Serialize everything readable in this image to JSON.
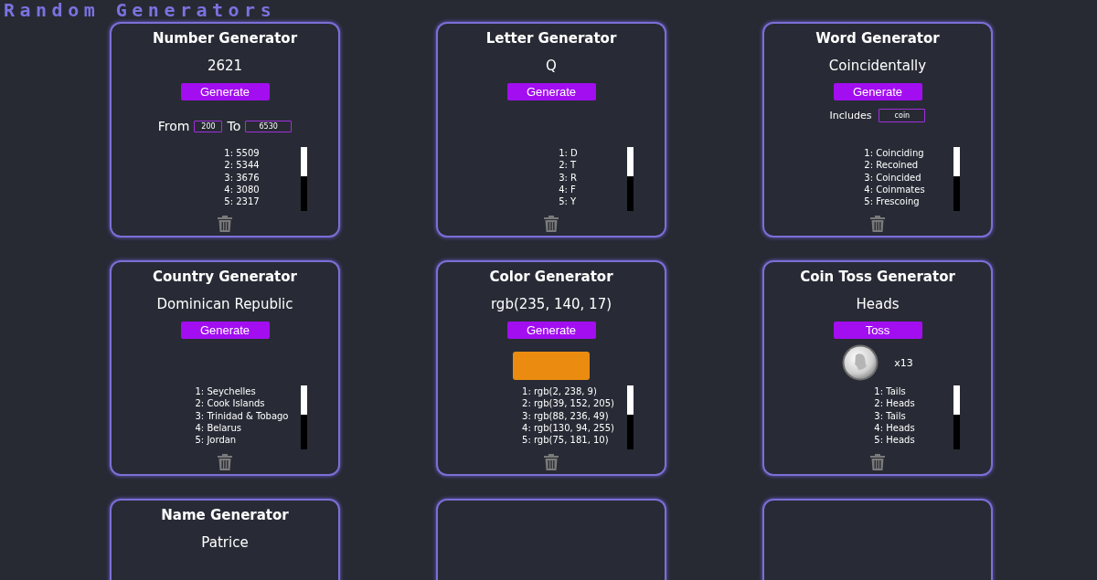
{
  "header": {
    "title": "Random Generators"
  },
  "cards": [
    {
      "kind": "number",
      "title": "Number Generator",
      "value": "2621",
      "button": "Generate",
      "range": {
        "from_label": "From",
        "from": "200",
        "to_label": "To",
        "to": "6530"
      },
      "history": [
        "1: 5509",
        "2: 5344",
        "3: 3676",
        "4: 3080",
        "5: 2317"
      ]
    },
    {
      "kind": "letter",
      "title": "Letter Generator",
      "value": "Q",
      "button": "Generate",
      "history": [
        "1: D",
        "2: T",
        "3: R",
        "4: F",
        "5: Y"
      ]
    },
    {
      "kind": "word",
      "title": "Word Generator",
      "value": "Coincidentally",
      "button": "Generate",
      "filter": {
        "label": "Includes",
        "value": "coin"
      },
      "history": [
        "1: Coinciding",
        "2: Recoined",
        "3: Coincided",
        "4: Coinmates",
        "5: Frescoing"
      ]
    },
    {
      "kind": "country",
      "title": "Country Generator",
      "value": "Dominican Republic",
      "button": "Generate",
      "history": [
        "1: Seychelles",
        "2: Cook Islands",
        "3: Trinidad & Tobago",
        "4: Belarus",
        "5: Jordan"
      ]
    },
    {
      "kind": "color",
      "title": "Color Generator",
      "value": "rgb(235, 140, 17)",
      "button": "Generate",
      "color": "#eb8c11",
      "history": [
        "1: rgb(2, 238, 9)",
        "2: rgb(39, 152, 205)",
        "3: rgb(88, 236, 49)",
        "4: rgb(130, 94, 255)",
        "5: rgb(75, 181, 10)"
      ]
    },
    {
      "kind": "coin",
      "title": "Coin Toss Generator",
      "value": "Heads",
      "button": "Toss",
      "streak": "x13",
      "history": [
        "1: Tails",
        "2: Heads",
        "3: Tails",
        "4: Heads",
        "5: Heads"
      ]
    },
    {
      "kind": "name",
      "title": "Name Generator",
      "value": "Patrice"
    },
    {
      "kind": "empty"
    },
    {
      "kind": "empty"
    }
  ]
}
